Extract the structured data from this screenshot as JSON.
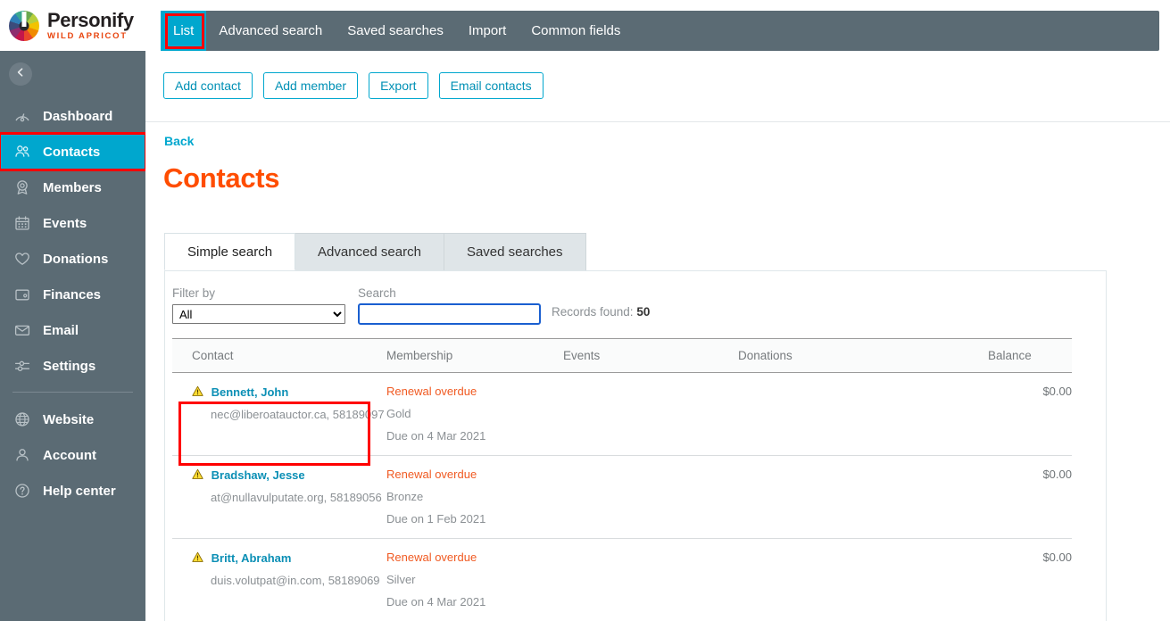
{
  "brand": {
    "name": "Personify",
    "tagline": "WILD APRICOT",
    "logo_icon": "pinwheel-logo-icon",
    "accent_cyan": "#00a7ce",
    "accent_orange": "#ff4d00",
    "sidebar_bg": "#5b6b74",
    "highlight_red": "#ff0000"
  },
  "sidebar": {
    "collapse_icon": "chevron-left-icon",
    "items": [
      {
        "label": "Dashboard",
        "icon": "gauge-icon",
        "active": false
      },
      {
        "label": "Contacts",
        "icon": "people-icon",
        "active": true
      },
      {
        "label": "Members",
        "icon": "badge-icon",
        "active": false
      },
      {
        "label": "Events",
        "icon": "calendar-icon",
        "active": false
      },
      {
        "label": "Donations",
        "icon": "heart-icon",
        "active": false
      },
      {
        "label": "Finances",
        "icon": "wallet-icon",
        "active": false
      },
      {
        "label": "Email",
        "icon": "envelope-icon",
        "active": false
      },
      {
        "label": "Settings",
        "icon": "sliders-icon",
        "active": false
      }
    ],
    "items_secondary": [
      {
        "label": "Website",
        "icon": "globe-icon",
        "active": false
      },
      {
        "label": "Account",
        "icon": "person-icon",
        "active": false
      },
      {
        "label": "Help center",
        "icon": "question-circle-icon",
        "active": false
      }
    ]
  },
  "topbar": {
    "tabs": [
      {
        "label": "List",
        "active": true
      },
      {
        "label": "Advanced search",
        "active": false
      },
      {
        "label": "Saved searches",
        "active": false
      },
      {
        "label": "Import",
        "active": false
      },
      {
        "label": "Common fields",
        "active": false
      }
    ]
  },
  "actionbar": {
    "buttons": [
      {
        "label": "Add contact"
      },
      {
        "label": "Add member"
      },
      {
        "label": "Export"
      },
      {
        "label": "Email contacts"
      }
    ]
  },
  "main": {
    "back_label": "Back",
    "title": "Contacts",
    "search_tabs": [
      {
        "label": "Simple search",
        "active": true
      },
      {
        "label": "Advanced search",
        "active": false
      },
      {
        "label": "Saved searches",
        "active": false
      }
    ],
    "filter": {
      "label": "Filter by",
      "value": "All",
      "options": [
        "All"
      ]
    },
    "search": {
      "label": "Search",
      "value": "",
      "placeholder": ""
    },
    "records_found_label": "Records found:",
    "records_found_value": "50",
    "table": {
      "columns": [
        "Contact",
        "Membership",
        "Events",
        "Donations",
        "Balance"
      ],
      "rows": [
        {
          "warn_icon": "warning-triangle-icon",
          "name": "Bennett, John",
          "sub": "nec@liberoatauctor.ca, 58189097",
          "membership_status": "Renewal overdue",
          "membership_level": "Gold",
          "membership_due": "Due on 4 Mar 2021",
          "events": "",
          "donations": "",
          "balance": "$0.00",
          "highlighted": true
        },
        {
          "warn_icon": "warning-triangle-icon",
          "name": "Bradshaw, Jesse",
          "sub": "at@nullavulputate.org, 58189056",
          "membership_status": "Renewal overdue",
          "membership_level": "Bronze",
          "membership_due": "Due on 1 Feb 2021",
          "events": "",
          "donations": "",
          "balance": "$0.00",
          "highlighted": false
        },
        {
          "warn_icon": "warning-triangle-icon",
          "name": "Britt, Abraham",
          "sub": "duis.volutpat@in.com, 58189069",
          "membership_status": "Renewal overdue",
          "membership_level": "Silver",
          "membership_due": "Due on 4 Mar 2021",
          "events": "",
          "donations": "",
          "balance": "$0.00",
          "highlighted": false
        }
      ]
    }
  }
}
